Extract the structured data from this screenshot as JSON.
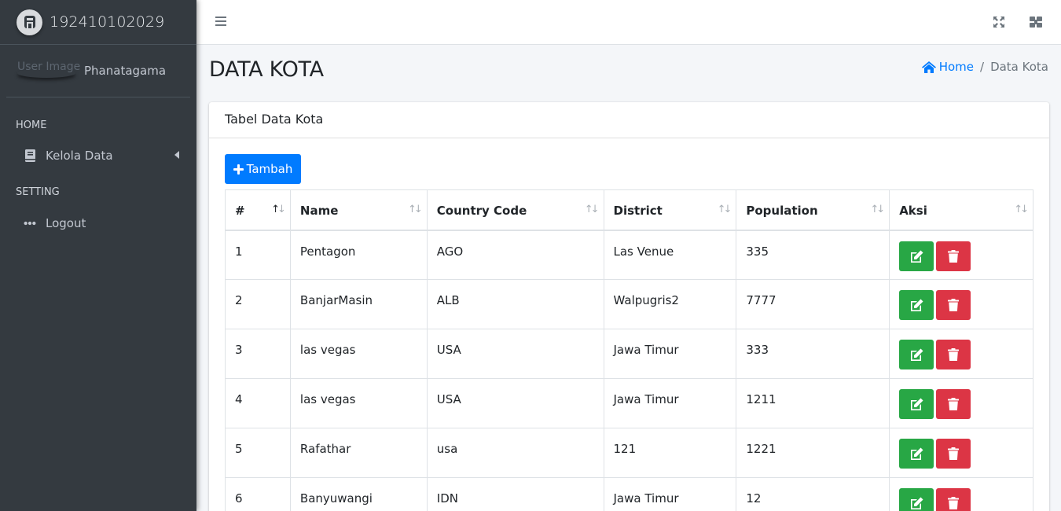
{
  "brand": {
    "text": "192410102029"
  },
  "user": {
    "image_alt": "User Image",
    "name": "Phanatagama"
  },
  "sidebar": {
    "header_home": "HOME",
    "kelola_label": "Kelola Data",
    "header_setting": "SETTING",
    "logout_label": "Logout"
  },
  "page": {
    "title": "DATA KOTA"
  },
  "breadcrumb": {
    "home": "Home",
    "current": "Data Kota"
  },
  "card": {
    "title": "Tabel Data Kota",
    "add_label": "Tambah"
  },
  "table": {
    "headers": [
      "#",
      "Name",
      "Country Code",
      "District",
      "Population",
      "Aksi"
    ],
    "rows": [
      [
        "1",
        "Pentagon",
        "AGO",
        "Las Venue",
        "335"
      ],
      [
        "2",
        "BanjarMasin",
        "ALB",
        "Walpugris2",
        "7777"
      ],
      [
        "3",
        "las vegas",
        "USA",
        "Jawa Timur",
        "333"
      ],
      [
        "4",
        "las vegas",
        "USA",
        "Jawa Timur",
        "1211"
      ],
      [
        "5",
        "Rafathar",
        "usa",
        "121",
        "1221"
      ],
      [
        "6",
        "Banyuwangi",
        "IDN",
        "Jawa Timur",
        "12"
      ]
    ]
  },
  "colors": {
    "sidebar_bg": "#343a40",
    "primary": "#007bff",
    "success": "#28a745",
    "danger": "#dc3545"
  },
  "icons": {
    "brand": "brand-logo-icon",
    "kelola": "book-icon",
    "logout": "ellipsis-icon",
    "menu": "hamburger-icon",
    "fullscreen": "expand-icon",
    "control_sidebar": "grid-icon",
    "home": "home-icon",
    "add": "plus-icon",
    "edit": "edit-icon",
    "delete": "trash-icon"
  }
}
